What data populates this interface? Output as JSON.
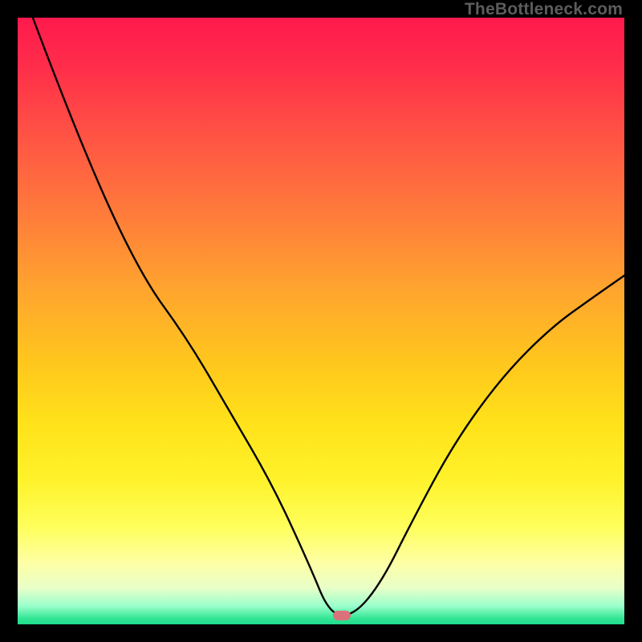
{
  "watermark": "TheBottleneck.com",
  "marker": {
    "x": 0.535,
    "y_from_top": 0.986
  },
  "chart_data": {
    "type": "line",
    "title": "",
    "xlabel": "",
    "ylabel": "",
    "xlim": [
      0,
      1
    ],
    "ylim": [
      0,
      1
    ],
    "grid": false,
    "legend": false,
    "annotations": [
      {
        "text": "TheBottleneck.com",
        "position": "top-right"
      }
    ],
    "series": [
      {
        "name": "bottleneck-curve",
        "x": [
          0.025,
          0.1,
          0.2,
          0.28,
          0.35,
          0.42,
          0.48,
          0.515,
          0.555,
          0.6,
          0.65,
          0.72,
          0.8,
          0.88,
          0.95,
          1.0
        ],
        "y": [
          1.0,
          0.8,
          0.58,
          0.47,
          0.35,
          0.23,
          0.1,
          0.015,
          0.015,
          0.07,
          0.17,
          0.3,
          0.41,
          0.49,
          0.54,
          0.575
        ],
        "note": "y=0 at bottom of plot, y=1 at top"
      }
    ],
    "marker_point": {
      "x": 0.535,
      "y": 0.014
    },
    "background_gradient": {
      "direction": "vertical",
      "stops": [
        {
          "pos": 0.0,
          "color": "#ff1a4d"
        },
        {
          "pos": 0.45,
          "color": "#ffa52e"
        },
        {
          "pos": 0.76,
          "color": "#fff22a"
        },
        {
          "pos": 0.94,
          "color": "#e8ffc8"
        },
        {
          "pos": 1.0,
          "color": "#1fdc8c"
        }
      ]
    }
  }
}
